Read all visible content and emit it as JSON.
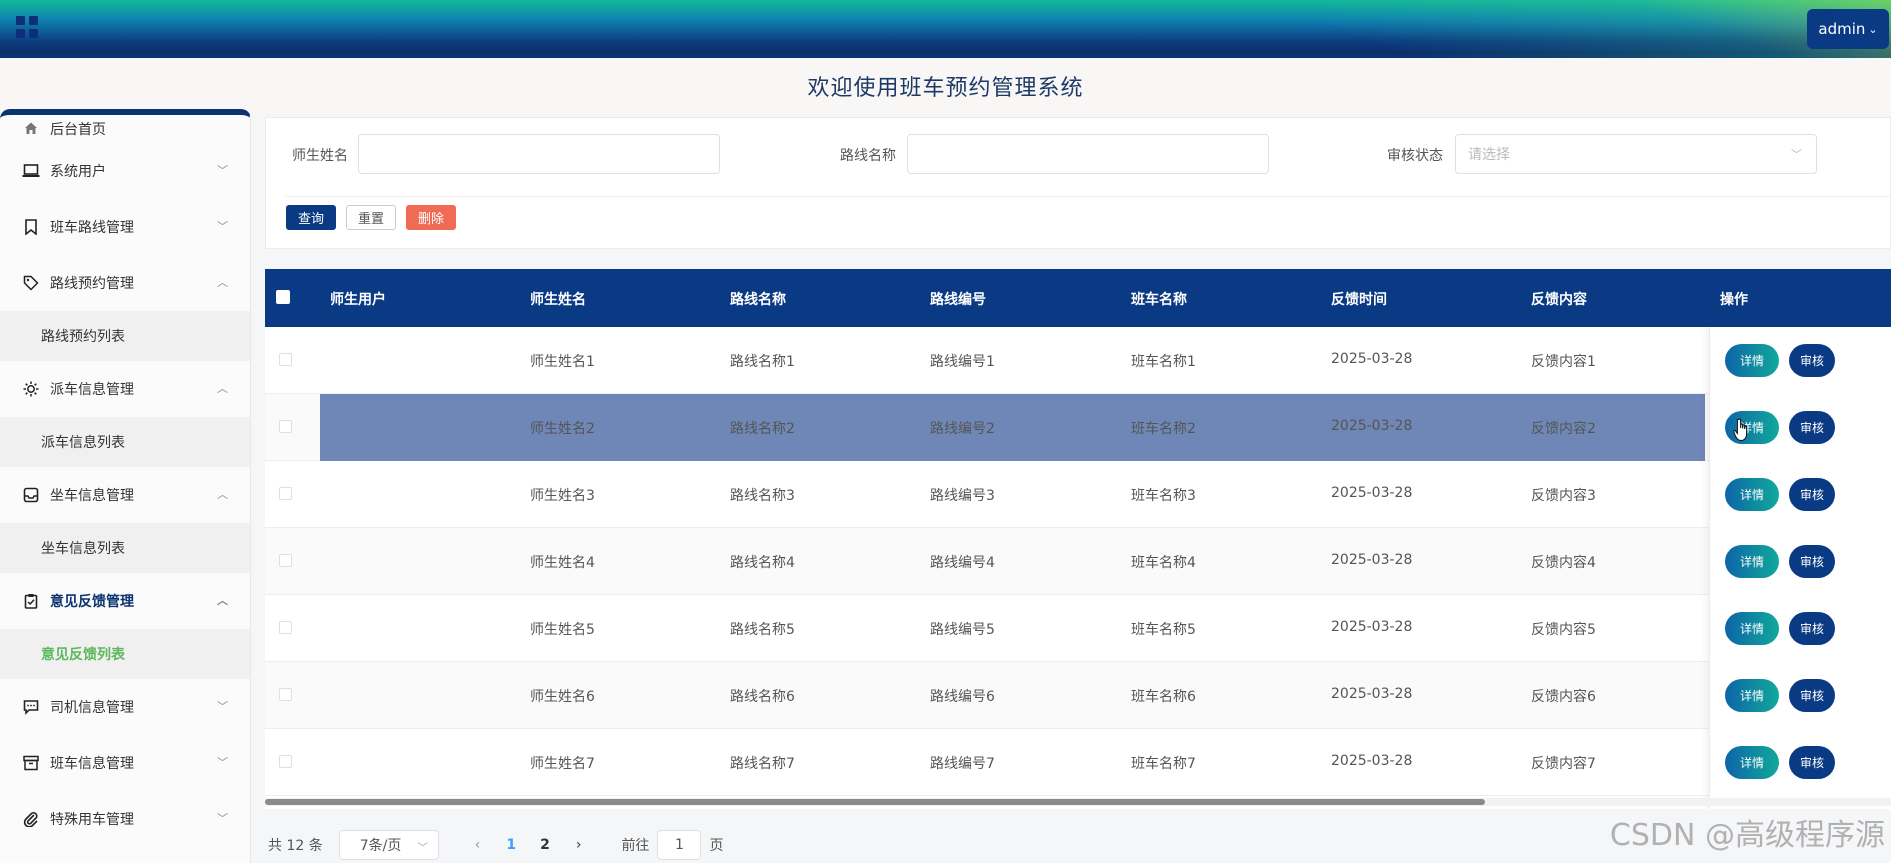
{
  "header": {
    "user_label": "admin",
    "title": "欢迎使用班车预约管理系统"
  },
  "sidebar": {
    "home": "后台首页",
    "items": [
      {
        "label": "系统用户",
        "icon": "laptop-icon"
      },
      {
        "label": "班车路线管理",
        "icon": "bookmark-icon"
      },
      {
        "label": "路线预约管理",
        "icon": "tag-icon",
        "expanded": true,
        "sub": "路线预约列表"
      },
      {
        "label": "派车信息管理",
        "icon": "sun-icon",
        "expanded": true,
        "sub": "派车信息列表"
      },
      {
        "label": "坐车信息管理",
        "icon": "inbox-icon",
        "expanded": true,
        "sub": "坐车信息列表"
      },
      {
        "label": "意见反馈管理",
        "icon": "clipboard-check-icon",
        "expanded": true,
        "sub": "意见反馈列表",
        "active": true
      },
      {
        "label": "司机信息管理",
        "icon": "chat-icon"
      },
      {
        "label": "班车信息管理",
        "icon": "archive-icon"
      },
      {
        "label": "特殊用车管理",
        "icon": "paperclip-icon"
      }
    ]
  },
  "filter": {
    "name_label": "师生姓名",
    "route_label": "路线名称",
    "status_label": "审核状态",
    "status_placeholder": "请选择",
    "query": "查询",
    "reset": "重置",
    "delete": "删除"
  },
  "table": {
    "columns": [
      "师生用户",
      "师生姓名",
      "路线名称",
      "路线编号",
      "班车名称",
      "反馈时间",
      "反馈内容",
      "操作"
    ],
    "rows": [
      [
        "",
        "师生姓名1",
        "路线名称1",
        "路线编号1",
        "班车名称1",
        "2025-03-28",
        "反馈内容1"
      ],
      [
        "",
        "师生姓名2",
        "路线名称2",
        "路线编号2",
        "班车名称2",
        "2025-03-28",
        "反馈内容2"
      ],
      [
        "",
        "师生姓名3",
        "路线名称3",
        "路线编号3",
        "班车名称3",
        "2025-03-28",
        "反馈内容3"
      ],
      [
        "",
        "师生姓名4",
        "路线名称4",
        "路线编号4",
        "班车名称4",
        "2025-03-28",
        "反馈内容4"
      ],
      [
        "",
        "师生姓名5",
        "路线名称5",
        "路线编号5",
        "班车名称5",
        "2025-03-28",
        "反馈内容5"
      ],
      [
        "",
        "师生姓名6",
        "路线名称6",
        "路线编号6",
        "班车名称6",
        "2025-03-28",
        "反馈内容6"
      ],
      [
        "",
        "师生姓名7",
        "路线名称7",
        "路线编号7",
        "班车名称7",
        "2025-03-28",
        "反馈内容7"
      ]
    ],
    "detail_label": "详情",
    "audit_label": "审核"
  },
  "pagination": {
    "total": "共 12 条",
    "page_size": "7条/页",
    "pages": [
      "1",
      "2"
    ],
    "current": "1",
    "goto_prefix": "前往",
    "goto_value": "1",
    "goto_suffix": "页"
  },
  "watermark": "CSDN @高级程序源",
  "colors": {
    "primary": "#0b3a84",
    "danger": "#f06b55",
    "active_menu": "#5cb85c",
    "selected_row": "#6f87b6"
  }
}
